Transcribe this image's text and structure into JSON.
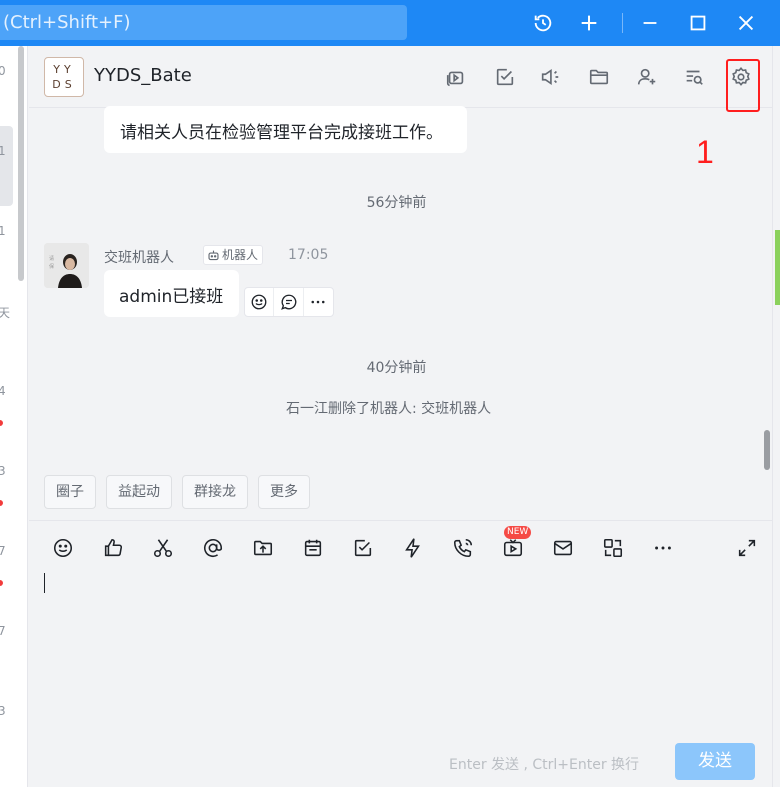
{
  "window": {
    "search_placeholder": "(Ctrl+Shift+F)"
  },
  "sidebar_peek": {
    "labels": [
      "0",
      "1",
      "1",
      "天",
      "4",
      "3",
      "7",
      "7",
      "3"
    ]
  },
  "chat": {
    "avatar_text": "YY DS",
    "title": "YYDS_Bate"
  },
  "messages": {
    "prev_text": "请相关人员在检验管理平台完成接班工作。",
    "time1": "56分钟前",
    "sender": "交班机器人",
    "bot_badge": "机器人",
    "sent_time": "17:05",
    "text": "admin已接班",
    "time2": "40分钟前",
    "system_notice": "石一江删除了机器人: 交班机器人"
  },
  "annotation": {
    "number": "1"
  },
  "quick_actions": [
    "圈子",
    "益起动",
    "群接龙",
    "更多"
  ],
  "composer": {
    "new_badge": "NEW",
    "hint": "Enter 发送 , Ctrl+Enter 换行",
    "send_label": "发送"
  },
  "colors": {
    "accent": "#1e88f5",
    "send_disabled": "#8cc6fb",
    "annotation_red": "#ff1e1e",
    "unread_dot": "#f23c3c"
  }
}
